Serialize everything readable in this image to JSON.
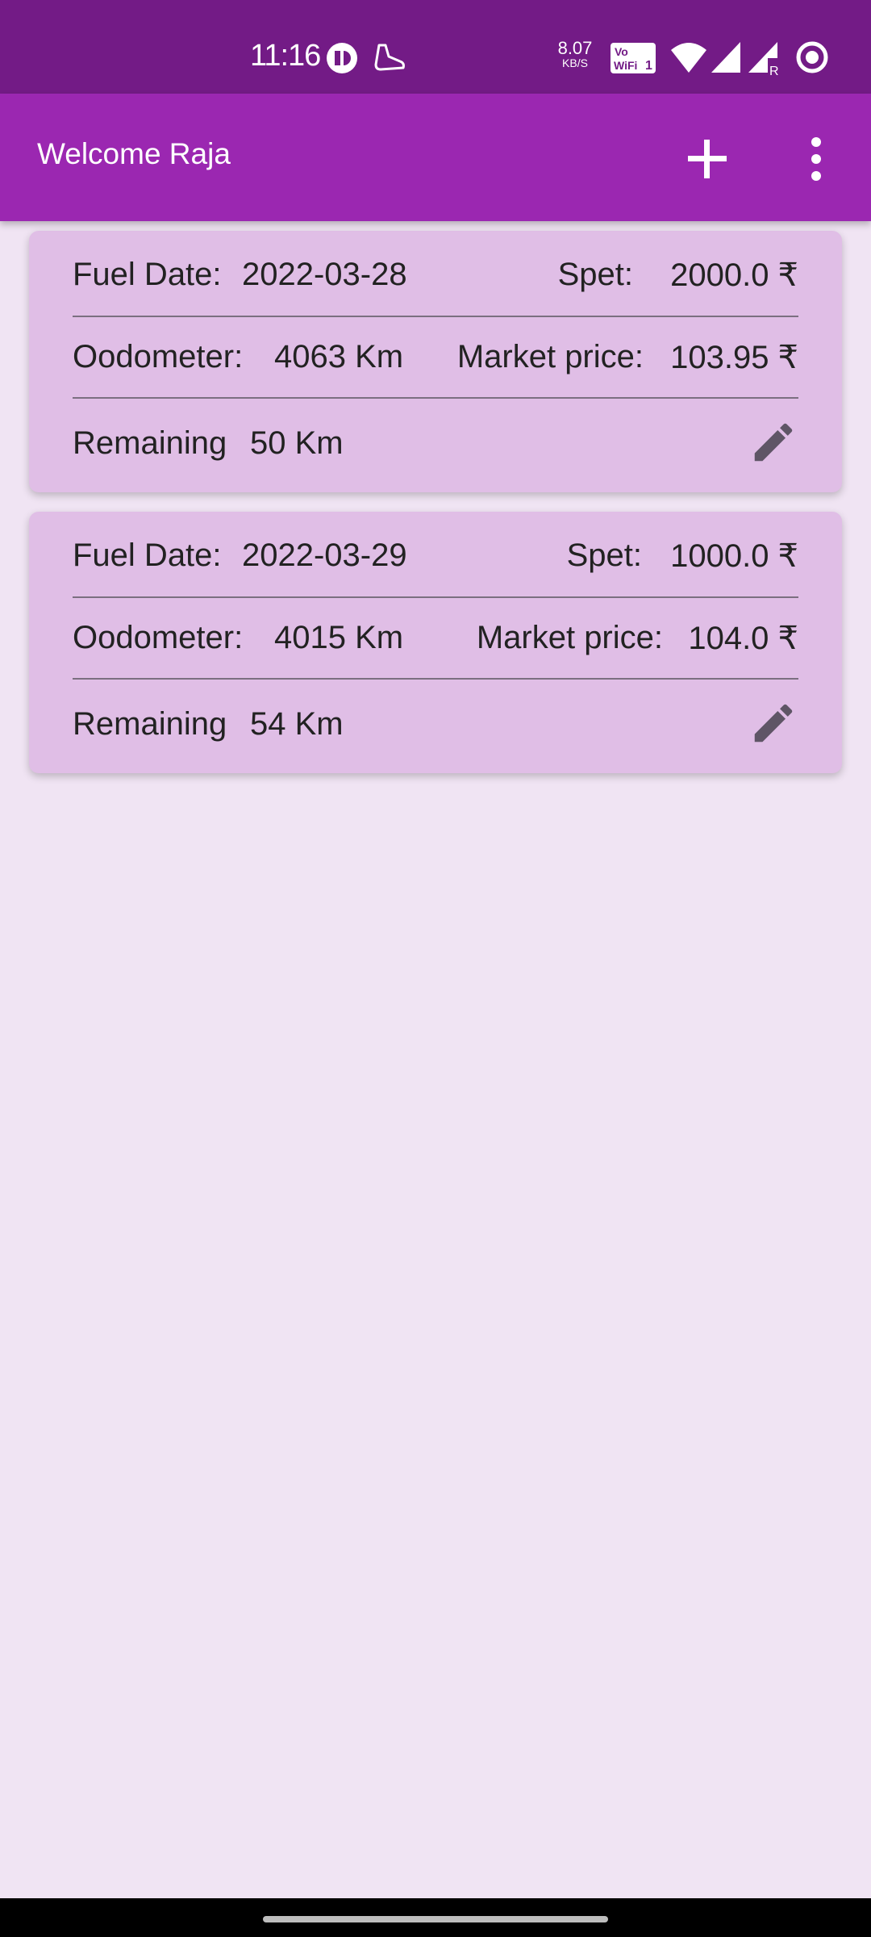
{
  "status_bar": {
    "time": "11:16",
    "speed_value": "8.07",
    "speed_unit": "KB/S",
    "icons": [
      "app-notification-icon",
      "shoe-icon",
      "vowifi-icon",
      "wifi-icon",
      "signal-icon",
      "signal-roaming-icon",
      "ring-icon"
    ]
  },
  "app_bar": {
    "title": "Welcome Raja",
    "add_icon": "plus-icon",
    "more_icon": "more-vert-icon"
  },
  "entries": [
    {
      "fuel_date_label": "Fuel Date:",
      "fuel_date": "2022-03-28",
      "spent_label": "Spet:",
      "spent": "2000.0 ₹",
      "odometer_label": "Oodometer:",
      "odometer": "4063 Km",
      "market_price_label": "Market price:",
      "market_price": "103.95 ₹",
      "remaining_label": "Remaining",
      "remaining": "50 Km",
      "edit_icon": "pencil-icon"
    },
    {
      "fuel_date_label": "Fuel Date:",
      "fuel_date": "2022-03-29",
      "spent_label": "Spet:",
      "spent": "1000.0 ₹",
      "odometer_label": "Oodometer:",
      "odometer": "4015 Km",
      "market_price_label": "Market price:",
      "market_price": "104.0 ₹",
      "remaining_label": "Remaining",
      "remaining": "54 Km",
      "edit_icon": "pencil-icon"
    }
  ],
  "colors": {
    "status_bar": "#731b86",
    "app_bar": "#9b27b1",
    "card": "#e0bee6",
    "background": "#f0e4f3"
  }
}
